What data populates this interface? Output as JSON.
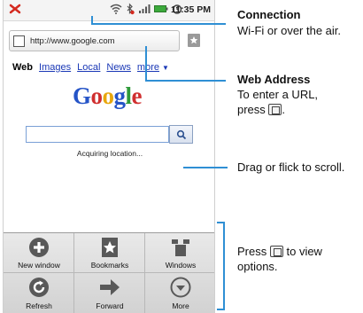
{
  "status_bar": {
    "time": "11:35 PM"
  },
  "browser": {
    "url": "http://www.google.com",
    "search_tabs": [
      "Web",
      "Images",
      "Local",
      "News",
      "more"
    ],
    "logo_letters": [
      "G",
      "o",
      "o",
      "g",
      "l",
      "e"
    ],
    "search_placeholder": "",
    "status_text": "Acquiring location..."
  },
  "menu": {
    "items": [
      {
        "label": "New window",
        "icon": "plus-circle-icon"
      },
      {
        "label": "Bookmarks",
        "icon": "bookmark-star-icon"
      },
      {
        "label": "Windows",
        "icon": "windows-icon"
      },
      {
        "label": "Refresh",
        "icon": "refresh-icon"
      },
      {
        "label": "Forward",
        "icon": "forward-arrow-icon"
      },
      {
        "label": "More",
        "icon": "chevron-down-circle-icon"
      }
    ]
  },
  "callouts": {
    "connection": {
      "title": "Connection",
      "text": "Wi-Fi or over the air."
    },
    "web_address": {
      "title": "Web Address",
      "line1": "To enter a URL,",
      "line2_pre": "press",
      "line2_post": "."
    },
    "scroll": {
      "text": "Drag or flick to scroll."
    },
    "options": {
      "pre": "Press",
      "post": "to view",
      "line2": "options."
    }
  },
  "colors": {
    "callout_line": "#2f8fd4",
    "link": "#1a38b6"
  }
}
